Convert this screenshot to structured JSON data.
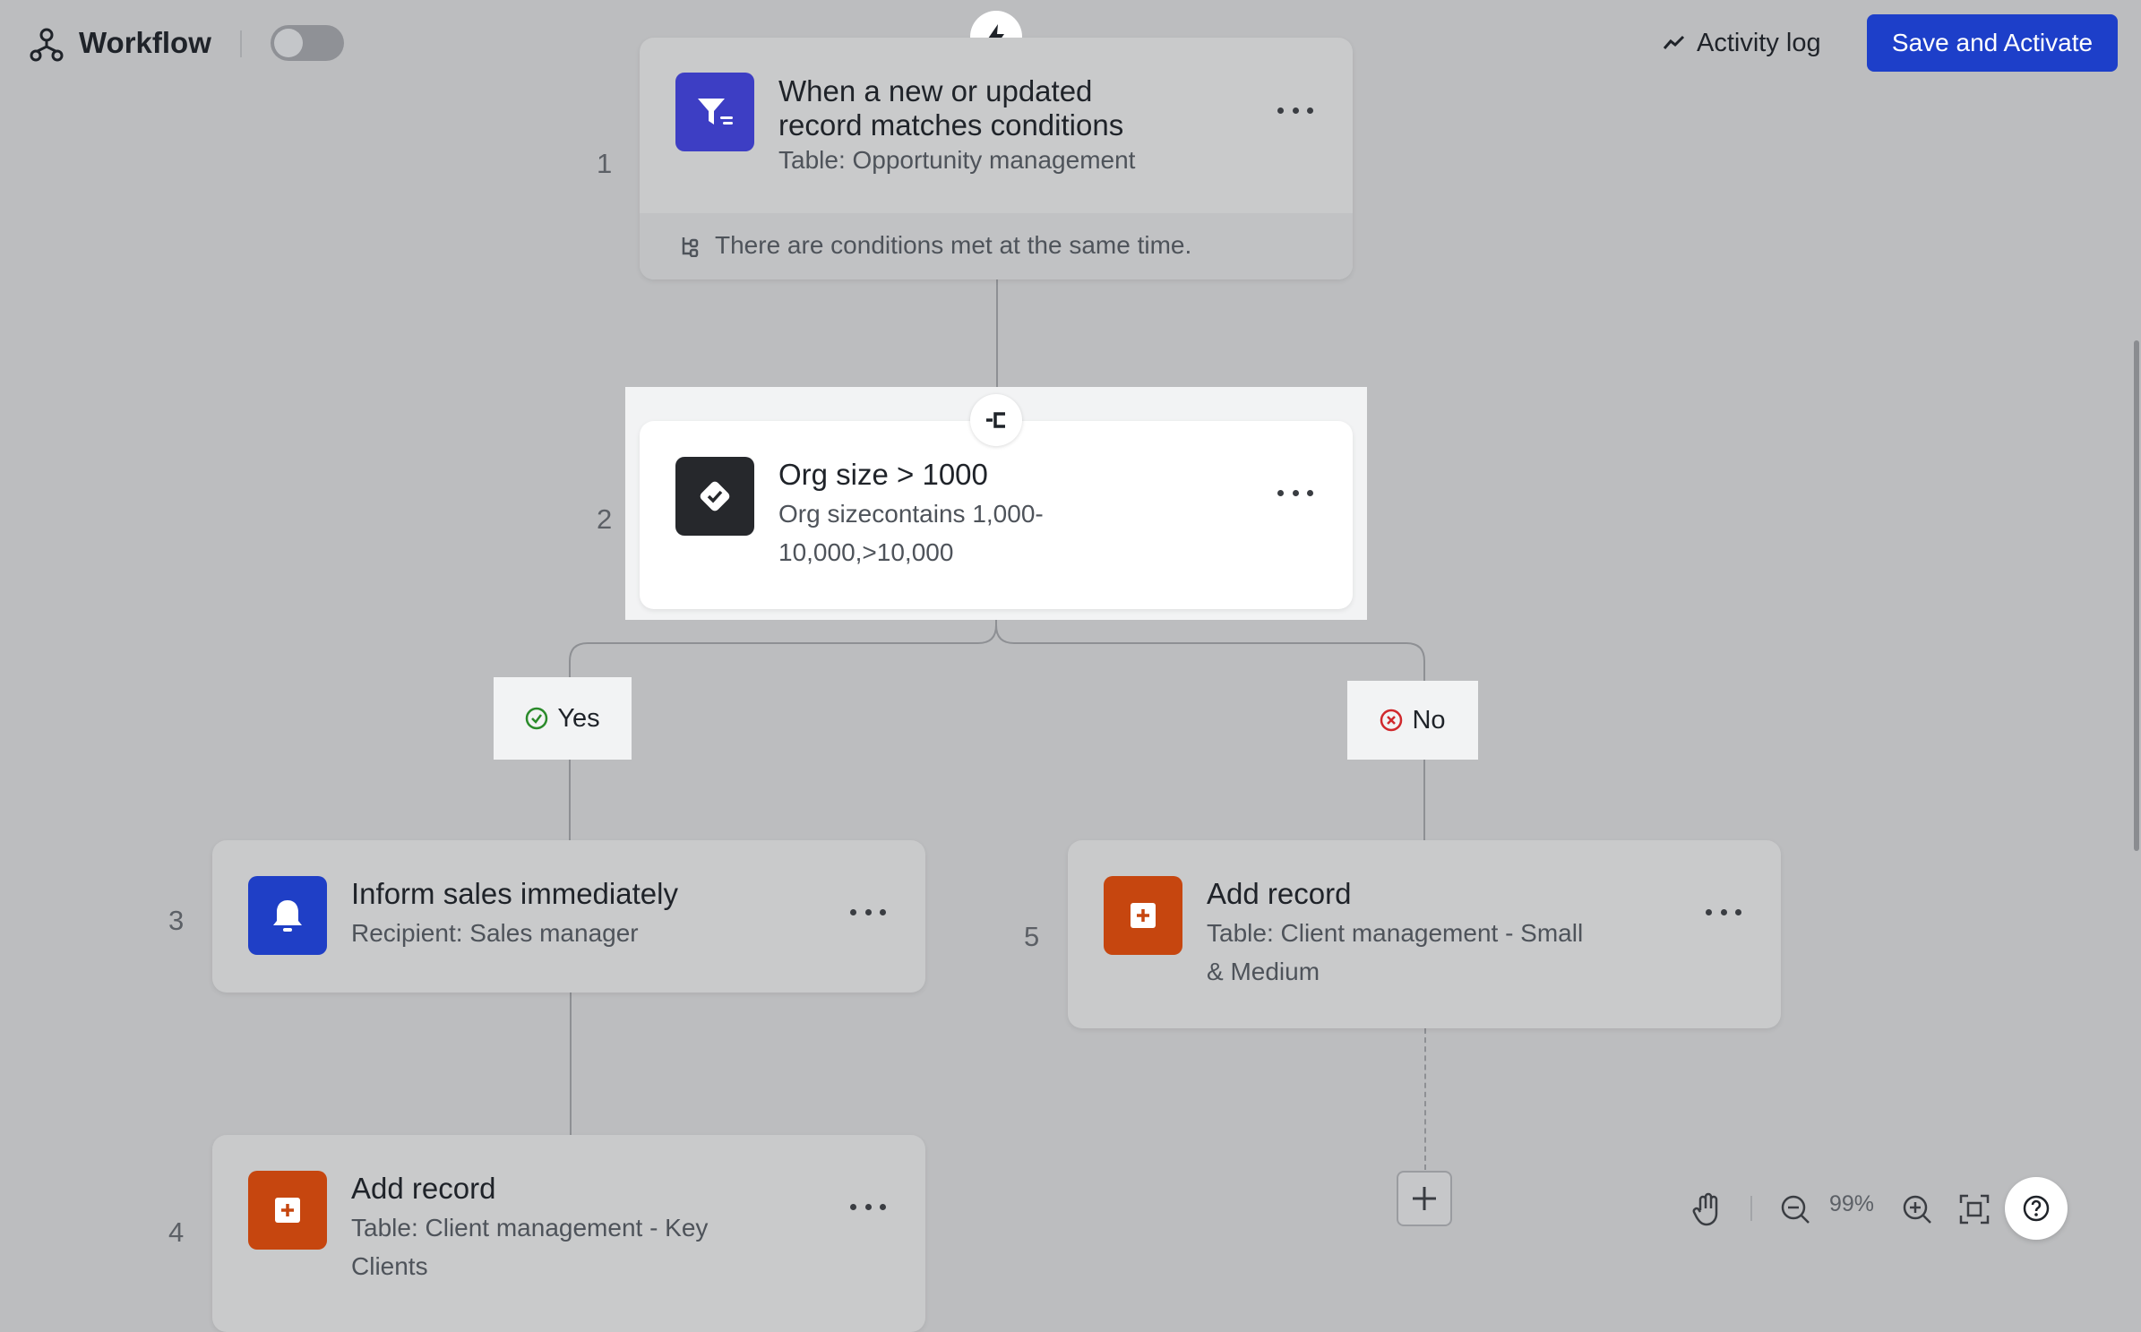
{
  "header": {
    "title": "Workflow",
    "icon": "workflow-icon",
    "toggle_state": "off",
    "activity_label": "Activity log",
    "save_label": "Save and Activate"
  },
  "colors": {
    "canvas_bg": "#bcbdbf",
    "primary": "#1d3fc9",
    "trigger_icon": "#3d3ec4",
    "condition_icon": "#26282c",
    "notify_icon": "#1f3fc6",
    "add_record_icon": "#c6460f",
    "yes": "#2a8a2a",
    "no": "#d0282c"
  },
  "nodes": {
    "trigger": {
      "number": "1",
      "title_line1": "When a new or updated",
      "title_line2": "record matches conditions",
      "subtitle": "Table: Opportunity management",
      "footer": "There are conditions met at the same time.",
      "icon": "filter-icon"
    },
    "condition": {
      "number": "2",
      "title": "Org size > 1000",
      "subtitle_line1": "Org sizecontains 1,000-",
      "subtitle_line2": "10,000,>10,000",
      "icon": "check-diamond-icon"
    },
    "inform": {
      "number": "3",
      "title": "Inform sales immediately",
      "subtitle": "Recipient: Sales manager",
      "icon": "bell-icon"
    },
    "add_key": {
      "number": "4",
      "title": "Add record",
      "subtitle_line1": "Table: Client management - Key",
      "subtitle_line2": "Clients",
      "icon": "add-record-icon"
    },
    "add_small": {
      "number": "5",
      "title": "Add record",
      "subtitle_line1": "Table: Client management - Small",
      "subtitle_line2": "& Medium",
      "icon": "add-record-icon"
    }
  },
  "branches": {
    "yes_label": "Yes",
    "no_label": "No"
  },
  "toolbar": {
    "zoom": "99%"
  }
}
